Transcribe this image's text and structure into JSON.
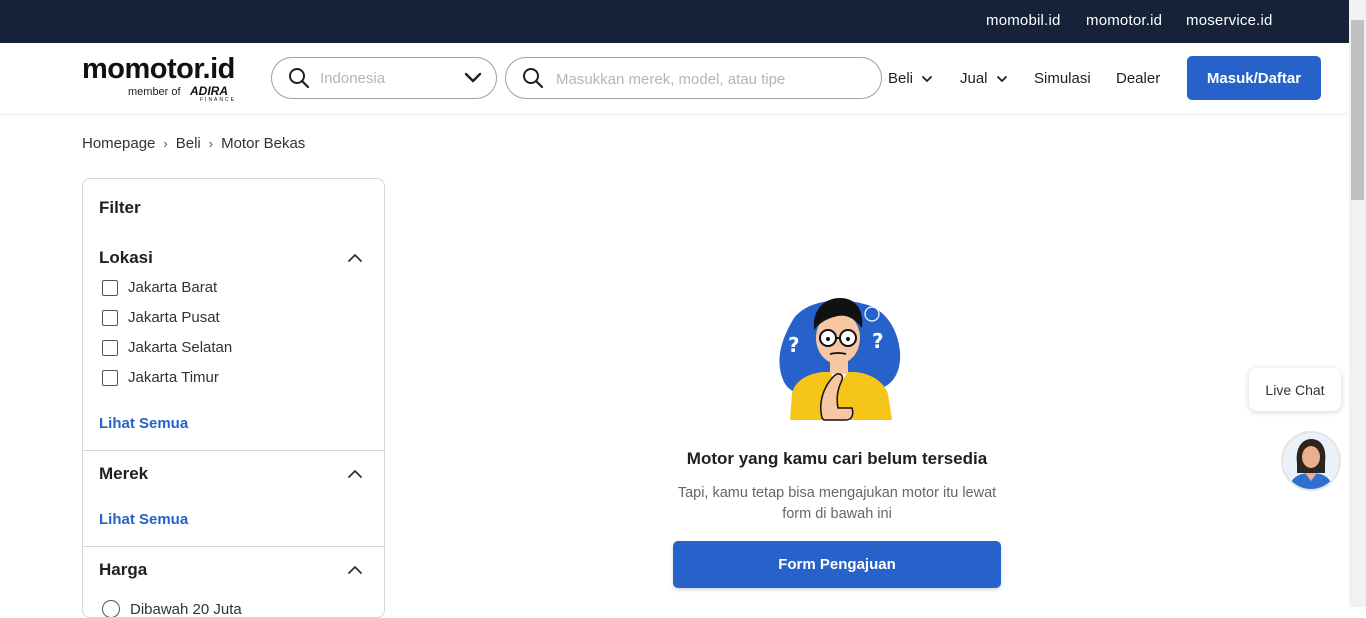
{
  "topbar": {
    "links": [
      {
        "label": "momobil.id"
      },
      {
        "label": "momotor.id"
      },
      {
        "label": "moservice.id"
      }
    ]
  },
  "header": {
    "logo_main": "momotor.id",
    "logo_sub": "member of",
    "logo_brand": "ADIRA",
    "logo_brand_sub": "FINANCE",
    "location_placeholder": "Indonesia",
    "search_placeholder": "Masukkan merek, model, atau tipe",
    "nav": {
      "beli": "Beli",
      "jual": "Jual",
      "simulasi": "Simulasi",
      "dealer": "Dealer"
    },
    "login_label": "Masuk/Daftar"
  },
  "breadcrumb": [
    "Homepage",
    "Beli",
    "Motor Bekas"
  ],
  "filter": {
    "title": "Filter",
    "lokasi": {
      "title": "Lokasi",
      "options": [
        "Jakarta Barat",
        "Jakarta Pusat",
        "Jakarta Selatan",
        "Jakarta Timur"
      ],
      "see_all": "Lihat Semua"
    },
    "merek": {
      "title": "Merek",
      "see_all": "Lihat Semua"
    },
    "harga": {
      "title": "Harga",
      "first_option": "Dibawah 20 Juta"
    }
  },
  "empty_state": {
    "title": "Motor yang kamu cari belum tersedia",
    "description": "Tapi, kamu tetap bisa mengajukan motor itu lewat form di bawah ini",
    "button": "Form Pengajuan"
  },
  "live_chat": {
    "label": "Live Chat"
  },
  "colors": {
    "topbar": "#152238",
    "primary": "#2662c9"
  }
}
